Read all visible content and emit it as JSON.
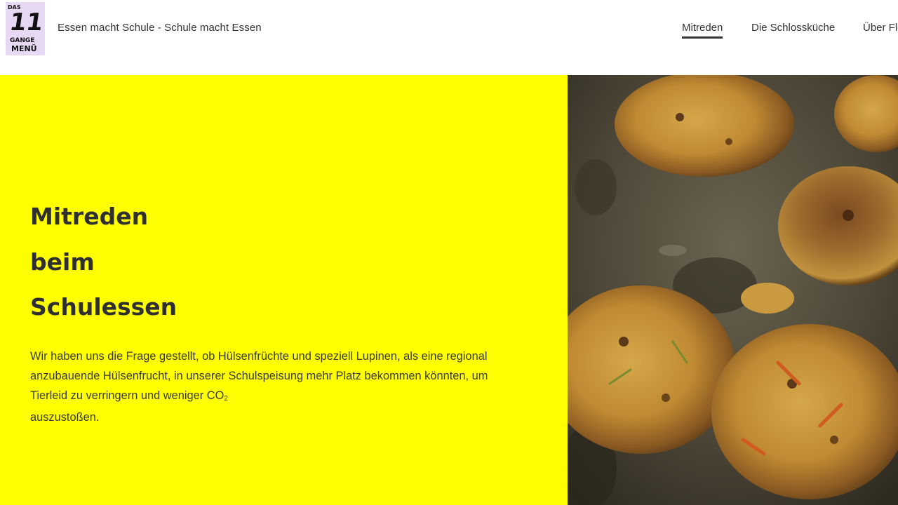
{
  "header": {
    "logo": {
      "lines": [
        "DAS",
        "11",
        "GANGE",
        "MENÜ"
      ]
    },
    "site_title": "Essen macht Schule - Schule macht Essen",
    "nav": [
      {
        "label": "Mitreden",
        "active": true
      },
      {
        "label": "Die Schlossküche",
        "active": false
      },
      {
        "label": "Über Flo",
        "active": false
      }
    ]
  },
  "hero": {
    "background_color": "#ffff00",
    "title_lines": [
      "Mitreden",
      "beim",
      "Schulessen"
    ],
    "text_main": "Wir haben uns die Frage gestellt, ob Hülsenfrüchte und speziell Lupinen, als eine regional anzubauende Hülsenfrucht, in unserer Schulspeisung mehr Platz bekommen könnten, um Tierleid zu verringern und weniger CO",
    "text_sub": "2",
    "text_end": "auszustoßen.",
    "image_alt": "patties-in-pan"
  },
  "colors": {
    "accent_yellow": "#ffff00",
    "logo_bg": "#e7d9f3",
    "text": "#2f2f2f"
  }
}
